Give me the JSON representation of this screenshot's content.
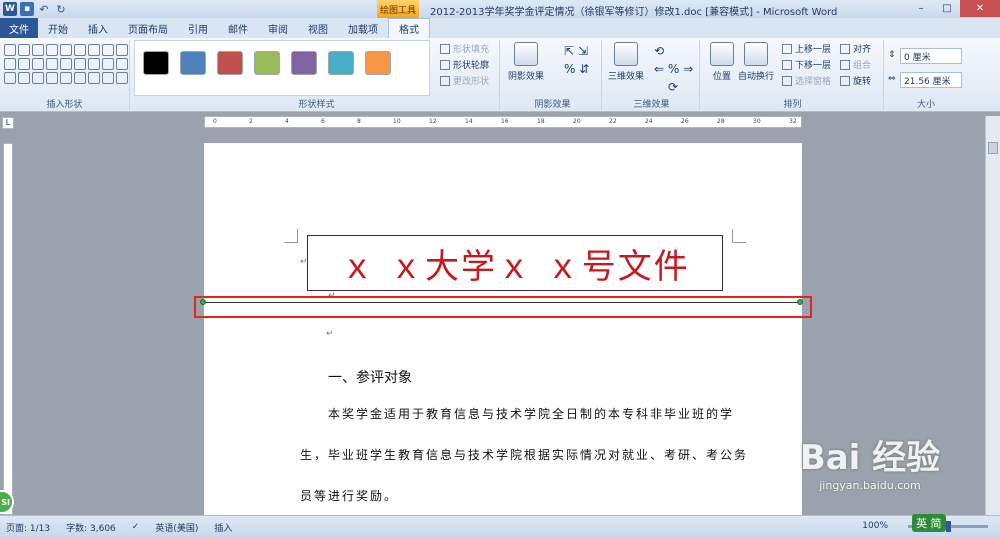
{
  "window": {
    "title": "2012-2013学年奖学金评定情况（徐银军等修订）修改1.doc [兼容模式] - Microsoft Word",
    "tool_context": "绘图工具"
  },
  "tabs": [
    {
      "label": "文件"
    },
    {
      "label": "开始"
    },
    {
      "label": "插入"
    },
    {
      "label": "页面布局"
    },
    {
      "label": "引用"
    },
    {
      "label": "邮件"
    },
    {
      "label": "审阅"
    },
    {
      "label": "视图"
    },
    {
      "label": "加载项"
    },
    {
      "label": "格式"
    }
  ],
  "ribbon": {
    "insert_shapes_label": "插入形状",
    "shape_styles_label": "形状样式",
    "style_colors": [
      "#000000",
      "#4f81bd",
      "#c0504d",
      "#9bbb59",
      "#8064a2",
      "#4bacc6",
      "#f79646"
    ],
    "shape_fill": "形状填充",
    "shape_outline": "形状轮廓",
    "change_shape": "更改形状",
    "shadow_effects_btn": "阴影效果",
    "shadow_effects_label": "阴影效果",
    "three_d_btn": "三维效果",
    "three_d_label": "三维效果",
    "position": "位置",
    "wrap_text": "自动换行",
    "bring_forward": "上移一层",
    "send_backward": "下移一层",
    "selection_pane": "选择窗格",
    "align": "对齐",
    "group": "组合",
    "rotate": "旋转",
    "arrange_label": "排列",
    "height": "0 厘米",
    "width": "21.56 厘米",
    "size_label": "大小"
  },
  "document": {
    "title": "ｘ ｘ大学ｘ ｘ号文件",
    "section_heading": "一、参评对象",
    "body_lines": [
      "本奖学金适用于教育信息与技术学院全日制的本专科非毕业班的学",
      "生，毕业班学生教育信息与技术学院根据实际情况对就业、考研、考公务",
      "员等进行奖励。"
    ]
  },
  "status": {
    "page": "页面: 1/13",
    "words": "字数: 3,606",
    "language": "英语(美国)",
    "mode": "插入",
    "zoom": "100%"
  },
  "watermark": {
    "brand": "Bai 经验",
    "url": "jingyan.baidu.com"
  },
  "ime": "英 简"
}
